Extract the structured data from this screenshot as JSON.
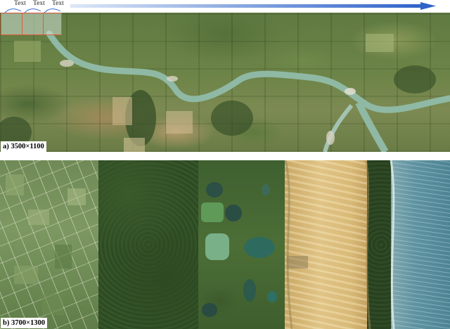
{
  "figure": {
    "panel_a": {
      "label": "a) 3500×1100"
    },
    "panel_b": {
      "label": "b) 3700×1300"
    },
    "patches": [
      {
        "label": "Text"
      },
      {
        "label": "Text"
      },
      {
        "label": "Text"
      }
    ],
    "colors": {
      "patch_border": "#e05a3a",
      "arrow": "#3a6fd0",
      "river": "#8fb9a4"
    }
  }
}
